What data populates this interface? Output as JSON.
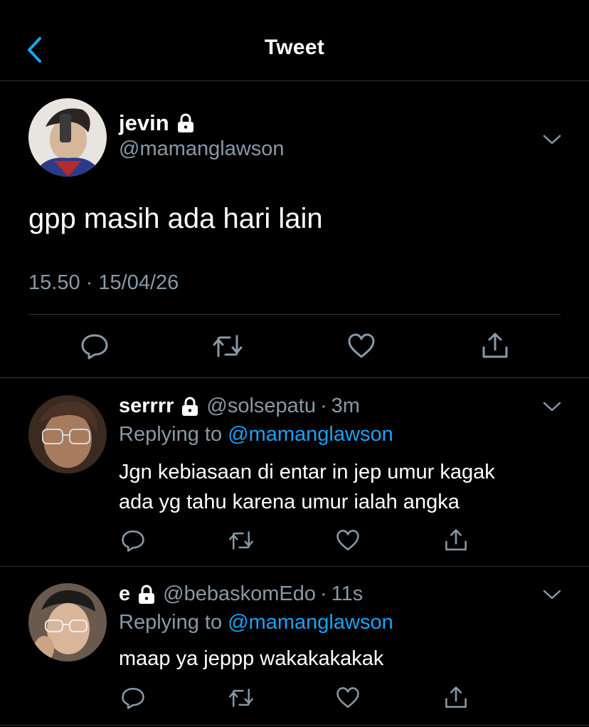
{
  "nav": {
    "title": "Tweet"
  },
  "tweet": {
    "name": "jevin",
    "handle": "@mamanglawson",
    "text": "gpp masih ada hari lain",
    "time": "15.50",
    "dot": "·",
    "date": "15/04/26"
  },
  "replies": [
    {
      "name": "serrrr",
      "handle": "@solsepatu",
      "dot": "·",
      "time": "3m",
      "replying_prefix": "Replying to",
      "replying_to": "@mamanglawson",
      "text_line1": "Jgn kebiasaan di entar in jep umur kagak",
      "text_line2": "ada yg tahu karena umur ialah angka"
    },
    {
      "name": "e",
      "handle": "@bebaskomEdo",
      "dot": "·",
      "time": "11s",
      "replying_prefix": "Replying to",
      "replying_to": "@mamanglawson",
      "text_line1": "maap ya jeppp wakakakakak",
      "text_line2": ""
    }
  ],
  "colors": {
    "accent": "#1da1f2",
    "secondary_text": "#8899a6",
    "divider": "#2f3336",
    "background": "#000000"
  },
  "icons": [
    "back-chevron-icon",
    "lock-icon",
    "chevron-down-icon",
    "reply-icon",
    "retweet-icon",
    "like-icon",
    "share-icon"
  ]
}
